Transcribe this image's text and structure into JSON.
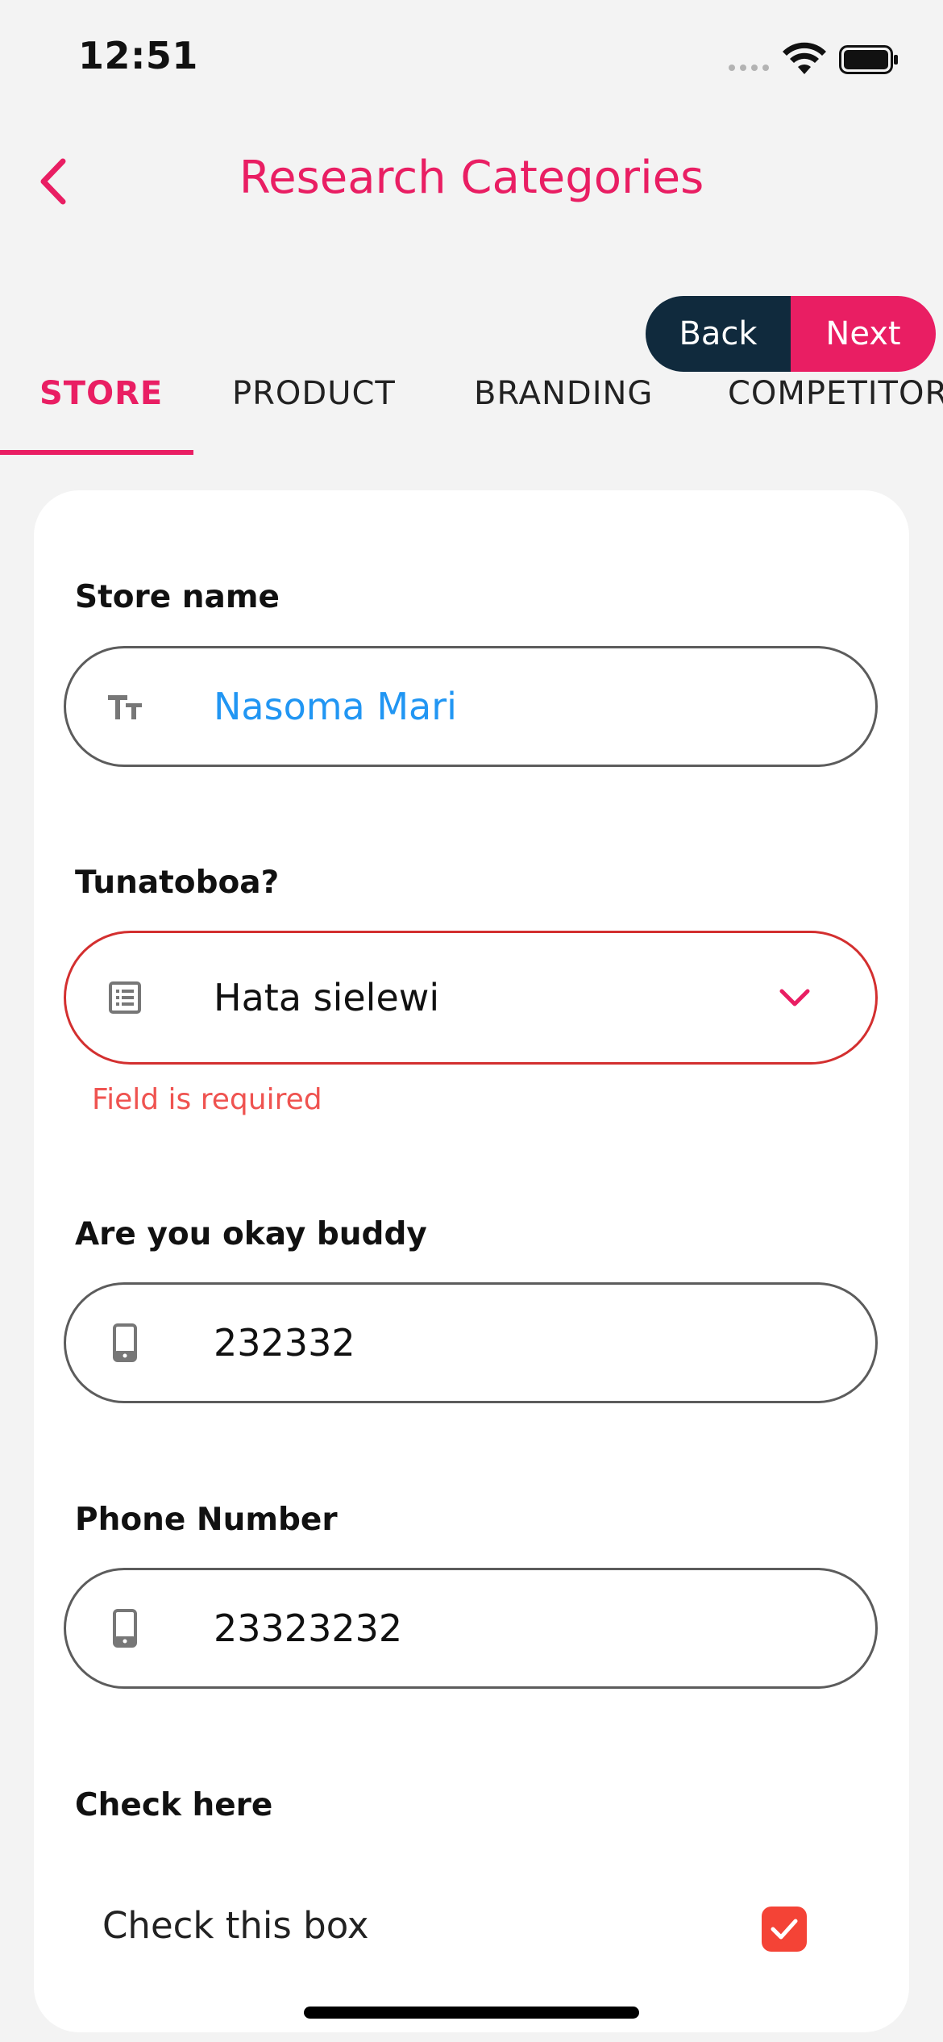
{
  "status_bar": {
    "time": "12:51"
  },
  "header": {
    "title": "Research Categories"
  },
  "nav_buttons": {
    "back_label": "Back",
    "next_label": "Next",
    "back_color": "#102a3d",
    "next_color": "#e91e63"
  },
  "tabs": [
    {
      "label": "STORE",
      "active": true
    },
    {
      "label": "PRODUCT",
      "active": false
    },
    {
      "label": "BRANDING",
      "active": false
    },
    {
      "label": "COMPETITOR",
      "active": false
    }
  ],
  "form": {
    "store_name": {
      "label": "Store name",
      "value": "Nasoma Mari",
      "icon": "text-format-icon"
    },
    "tunatoboa": {
      "label": "Tunatoboa?",
      "value": "Hata sielewi",
      "icon": "list-icon",
      "error": "Field is required"
    },
    "okay_buddy": {
      "label": "Are you okay buddy",
      "value": "232332",
      "icon": "phone-icon"
    },
    "phone_number": {
      "label": "Phone Number",
      "value": "23323232",
      "icon": "phone-icon"
    },
    "check": {
      "section_label": "Check here",
      "label": "Check this box",
      "checked": true
    }
  },
  "colors": {
    "accent": "#e91e63",
    "error": "#d32f2f",
    "link_value": "#2196f3",
    "checkbox": "#f44336"
  }
}
